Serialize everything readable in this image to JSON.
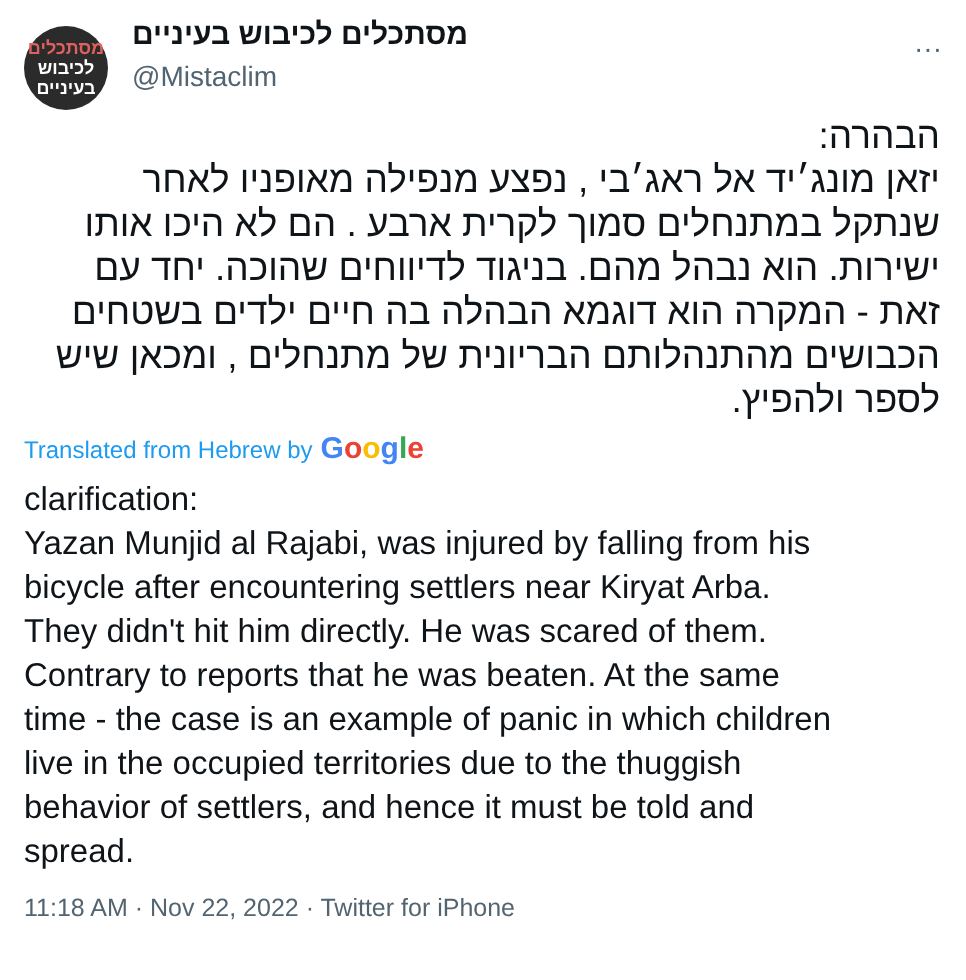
{
  "author": {
    "avatar_lines": [
      "מסתכלים",
      "לכיבוש",
      "בעיניים"
    ],
    "name": "מסתכלים לכיבוש בעיניים",
    "handle": "@Mistaclim"
  },
  "more_button": "···",
  "original_lines": [
    "הבהרה:",
    "יזאן מונג׳יד אל ראג׳בי , נפצע מנפילה מאופניו לאחר",
    "שנתקל במתנחלים סמוך לקרית ארבע . הם לא היכו אותו",
    "ישירות. הוא נבהל מהם. בניגוד לדיווחים שהוכה. יחד עם",
    "זאת - המקרה הוא דוגמא הבהלה בה חיים ילדים בשטחים",
    "הכבושים מהתנהלותם הבריונית של מתנחלים , ומכאן שיש",
    "לספר ולהפיץ."
  ],
  "translation_note": {
    "text": "Translated from Hebrew by",
    "brand": "Google"
  },
  "translation_lines": [
    "clarification:",
    "Yazan Munjid al Rajabi, was injured by falling from his",
    "bicycle after encountering settlers near Kiryat Arba.",
    "They didn't hit him directly. He was scared of them.",
    "Contrary to reports that he was beaten. At the same",
    "time - the case is an example of panic in which children",
    "live in the occupied territories due to the thuggish",
    "behavior of settlers, and hence it must be told and",
    "spread."
  ],
  "meta": "11:18 AM · Nov 22, 2022 · Twitter for iPhone"
}
